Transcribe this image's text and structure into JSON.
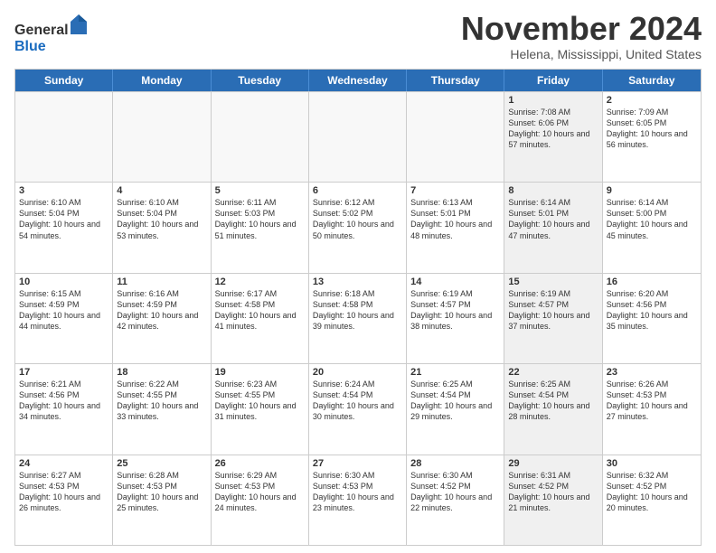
{
  "logo": {
    "general": "General",
    "blue": "Blue"
  },
  "header": {
    "month": "November 2024",
    "location": "Helena, Mississippi, United States"
  },
  "weekdays": [
    "Sunday",
    "Monday",
    "Tuesday",
    "Wednesday",
    "Thursday",
    "Friday",
    "Saturday"
  ],
  "rows": [
    [
      {
        "day": "",
        "text": "",
        "empty": true
      },
      {
        "day": "",
        "text": "",
        "empty": true
      },
      {
        "day": "",
        "text": "",
        "empty": true
      },
      {
        "day": "",
        "text": "",
        "empty": true
      },
      {
        "day": "",
        "text": "",
        "empty": true
      },
      {
        "day": "1",
        "text": "Sunrise: 7:08 AM\nSunset: 6:06 PM\nDaylight: 10 hours and 57 minutes.",
        "shaded": true
      },
      {
        "day": "2",
        "text": "Sunrise: 7:09 AM\nSunset: 6:05 PM\nDaylight: 10 hours and 56 minutes.",
        "shaded": false
      }
    ],
    [
      {
        "day": "3",
        "text": "Sunrise: 6:10 AM\nSunset: 5:04 PM\nDaylight: 10 hours and 54 minutes.",
        "shaded": false
      },
      {
        "day": "4",
        "text": "Sunrise: 6:10 AM\nSunset: 5:04 PM\nDaylight: 10 hours and 53 minutes.",
        "shaded": false
      },
      {
        "day": "5",
        "text": "Sunrise: 6:11 AM\nSunset: 5:03 PM\nDaylight: 10 hours and 51 minutes.",
        "shaded": false
      },
      {
        "day": "6",
        "text": "Sunrise: 6:12 AM\nSunset: 5:02 PM\nDaylight: 10 hours and 50 minutes.",
        "shaded": false
      },
      {
        "day": "7",
        "text": "Sunrise: 6:13 AM\nSunset: 5:01 PM\nDaylight: 10 hours and 48 minutes.",
        "shaded": false
      },
      {
        "day": "8",
        "text": "Sunrise: 6:14 AM\nSunset: 5:01 PM\nDaylight: 10 hours and 47 minutes.",
        "shaded": true
      },
      {
        "day": "9",
        "text": "Sunrise: 6:14 AM\nSunset: 5:00 PM\nDaylight: 10 hours and 45 minutes.",
        "shaded": false
      }
    ],
    [
      {
        "day": "10",
        "text": "Sunrise: 6:15 AM\nSunset: 4:59 PM\nDaylight: 10 hours and 44 minutes.",
        "shaded": false
      },
      {
        "day": "11",
        "text": "Sunrise: 6:16 AM\nSunset: 4:59 PM\nDaylight: 10 hours and 42 minutes.",
        "shaded": false
      },
      {
        "day": "12",
        "text": "Sunrise: 6:17 AM\nSunset: 4:58 PM\nDaylight: 10 hours and 41 minutes.",
        "shaded": false
      },
      {
        "day": "13",
        "text": "Sunrise: 6:18 AM\nSunset: 4:58 PM\nDaylight: 10 hours and 39 minutes.",
        "shaded": false
      },
      {
        "day": "14",
        "text": "Sunrise: 6:19 AM\nSunset: 4:57 PM\nDaylight: 10 hours and 38 minutes.",
        "shaded": false
      },
      {
        "day": "15",
        "text": "Sunrise: 6:19 AM\nSunset: 4:57 PM\nDaylight: 10 hours and 37 minutes.",
        "shaded": true
      },
      {
        "day": "16",
        "text": "Sunrise: 6:20 AM\nSunset: 4:56 PM\nDaylight: 10 hours and 35 minutes.",
        "shaded": false
      }
    ],
    [
      {
        "day": "17",
        "text": "Sunrise: 6:21 AM\nSunset: 4:56 PM\nDaylight: 10 hours and 34 minutes.",
        "shaded": false
      },
      {
        "day": "18",
        "text": "Sunrise: 6:22 AM\nSunset: 4:55 PM\nDaylight: 10 hours and 33 minutes.",
        "shaded": false
      },
      {
        "day": "19",
        "text": "Sunrise: 6:23 AM\nSunset: 4:55 PM\nDaylight: 10 hours and 31 minutes.",
        "shaded": false
      },
      {
        "day": "20",
        "text": "Sunrise: 6:24 AM\nSunset: 4:54 PM\nDaylight: 10 hours and 30 minutes.",
        "shaded": false
      },
      {
        "day": "21",
        "text": "Sunrise: 6:25 AM\nSunset: 4:54 PM\nDaylight: 10 hours and 29 minutes.",
        "shaded": false
      },
      {
        "day": "22",
        "text": "Sunrise: 6:25 AM\nSunset: 4:54 PM\nDaylight: 10 hours and 28 minutes.",
        "shaded": true
      },
      {
        "day": "23",
        "text": "Sunrise: 6:26 AM\nSunset: 4:53 PM\nDaylight: 10 hours and 27 minutes.",
        "shaded": false
      }
    ],
    [
      {
        "day": "24",
        "text": "Sunrise: 6:27 AM\nSunset: 4:53 PM\nDaylight: 10 hours and 26 minutes.",
        "shaded": false
      },
      {
        "day": "25",
        "text": "Sunrise: 6:28 AM\nSunset: 4:53 PM\nDaylight: 10 hours and 25 minutes.",
        "shaded": false
      },
      {
        "day": "26",
        "text": "Sunrise: 6:29 AM\nSunset: 4:53 PM\nDaylight: 10 hours and 24 minutes.",
        "shaded": false
      },
      {
        "day": "27",
        "text": "Sunrise: 6:30 AM\nSunset: 4:53 PM\nDaylight: 10 hours and 23 minutes.",
        "shaded": false
      },
      {
        "day": "28",
        "text": "Sunrise: 6:30 AM\nSunset: 4:52 PM\nDaylight: 10 hours and 22 minutes.",
        "shaded": false
      },
      {
        "day": "29",
        "text": "Sunrise: 6:31 AM\nSunset: 4:52 PM\nDaylight: 10 hours and 21 minutes.",
        "shaded": true
      },
      {
        "day": "30",
        "text": "Sunrise: 6:32 AM\nSunset: 4:52 PM\nDaylight: 10 hours and 20 minutes.",
        "shaded": false
      }
    ]
  ]
}
